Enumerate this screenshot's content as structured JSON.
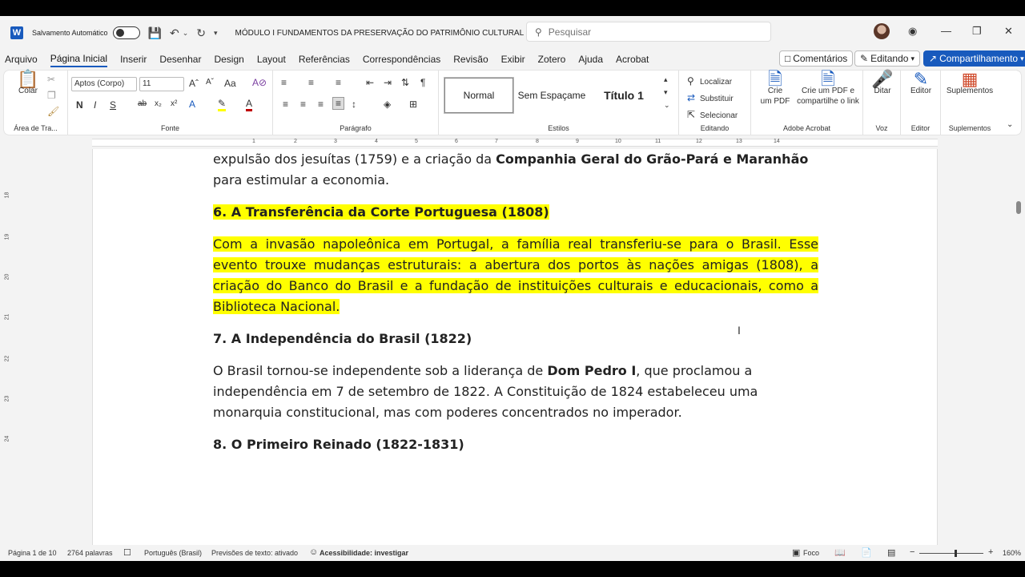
{
  "titlebar": {
    "autosave_label": "Salvamento Automático",
    "document_title": "MÓDULO I  FUNDAMENTOS DA PRESERVAÇÃO DO PATRIMÔNIO CULTURAL",
    "search_placeholder": "Pesquisar"
  },
  "tabs": [
    "Arquivo",
    "Página Inicial",
    "Inserir",
    "Desenhar",
    "Design",
    "Layout",
    "Referências",
    "Correspondências",
    "Revisão",
    "Exibir",
    "Zotero",
    "Ajuda",
    "Acrobat"
  ],
  "actions": {
    "comments": "Comentários",
    "editing": "Editando",
    "share": "Compartilhamento"
  },
  "ribbon": {
    "clipboard": {
      "paste": "Colar",
      "label": "Área de Tra..."
    },
    "font": {
      "family": "Aptos (Corpo)",
      "size": "11",
      "label": "Fonte"
    },
    "paragraph": {
      "label": "Parágrafo"
    },
    "styles": {
      "items": [
        "Normal",
        "Sem Espaçame",
        "Título 1"
      ],
      "label": "Estilos"
    },
    "editing": {
      "find": "Localizar",
      "replace": "Substituir",
      "select": "Selecionar",
      "label": "Editando"
    },
    "acrobat": {
      "create_pdf": "Crie\num PDF",
      "create_share": "Crie um PDF e\ncompartilhe o link",
      "label": "Adobe Acrobat"
    },
    "voice": {
      "dictate": "Ditar",
      "label": "Voz"
    },
    "editor": {
      "editor": "Editor",
      "label": "Editor"
    },
    "addins": {
      "addins": "Suplementos",
      "label": "Suplementos"
    }
  },
  "ruler": {
    "h_numbers": [
      "1",
      "2",
      "3",
      "4",
      "5",
      "6",
      "7",
      "8",
      "9",
      "10",
      "11",
      "12",
      "13",
      "14"
    ],
    "v_numbers": [
      "18",
      "19",
      "20",
      "21",
      "22",
      "23",
      "24"
    ]
  },
  "document": {
    "p1_prefix": "expulsão dos jesuítas (1759) e a criação da ",
    "p1_bold": "Companhia Geral do Grão-Pará e Maranhão",
    "p1_suffix": " para estimular a economia.",
    "h6": "6. A Transferência da Corte Portuguesa (1808)",
    "p6": "Com a invasão napoleônica em Portugal, a família real transferiu-se para o Brasil. Esse evento trouxe mudanças estruturais: a abertura dos portos às nações amigas (1808), a criação do Banco do Brasil e a fundação de instituições culturais e educacionais, como a Biblioteca Nacional.",
    "h7": "7. A Independência do Brasil (1822)",
    "p7_prefix": "O Brasil tornou-se independente sob a liderança de ",
    "p7_bold": "Dom Pedro I",
    "p7_suffix": ", que proclamou a independência em 7 de setembro de 1822. A Constituição de 1824 estabeleceu uma monarquia constitucional, mas com poderes concentrados no imperador.",
    "h8": "8. O Primeiro Reinado (1822-1831)"
  },
  "status": {
    "page": "Página 1 de 10",
    "words": "2764 palavras",
    "language": "Português (Brasil)",
    "predictions": "Previsões de texto: ativado",
    "accessibility": "Acessibilidade: investigar",
    "focus": "Foco",
    "zoom": "160%"
  }
}
